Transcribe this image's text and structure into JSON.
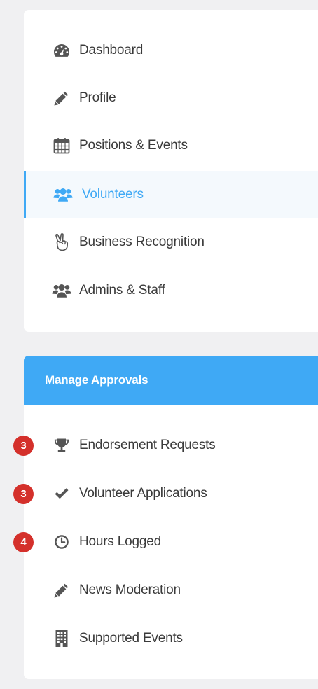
{
  "nav": {
    "items": [
      {
        "label": "Dashboard",
        "icon": "dashboard-gauge-icon"
      },
      {
        "label": "Profile",
        "icon": "pencil-icon"
      },
      {
        "label": "Positions & Events",
        "icon": "calendar-icon"
      },
      {
        "label": "Volunteers",
        "icon": "users-group-icon",
        "active": true
      },
      {
        "label": "Business Recognition",
        "icon": "peace-hand-icon"
      },
      {
        "label": "Admins & Staff",
        "icon": "users-group-icon"
      }
    ]
  },
  "approvals": {
    "title": "Manage Approvals",
    "items": [
      {
        "label": "Endorsement Requests",
        "icon": "trophy-icon",
        "badge": "3"
      },
      {
        "label": "Volunteer Applications",
        "icon": "checkmark-icon",
        "badge": "3"
      },
      {
        "label": "Hours Logged",
        "icon": "clock-icon",
        "badge": "4"
      },
      {
        "label": "News Moderation",
        "icon": "pencil-icon"
      },
      {
        "label": "Supported Events",
        "icon": "building-icon"
      }
    ]
  },
  "colors": {
    "accent": "#3fa9f5",
    "badge": "#d4302b",
    "icon": "#555555",
    "text": "#3a3a3a"
  }
}
